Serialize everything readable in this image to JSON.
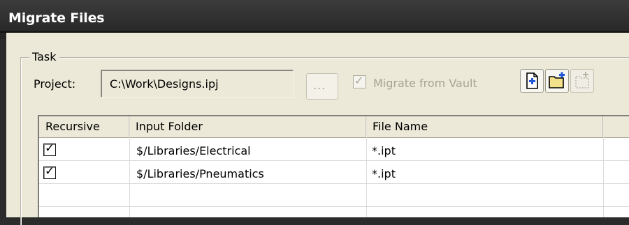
{
  "window": {
    "title": "Migrate Files"
  },
  "task": {
    "group_label": "Task",
    "project_label": "Project:",
    "project_value": "C:\\Work\\Designs.ipj",
    "browse_label": "...",
    "migrate_from_vault": {
      "label": "Migrate from Vault",
      "checked": true,
      "enabled": false
    }
  },
  "toolbar": {
    "buttons": [
      {
        "icon": "new-file-icon",
        "enabled": true
      },
      {
        "icon": "new-folder-icon",
        "enabled": true
      },
      {
        "icon": "remove-icon",
        "enabled": false
      }
    ]
  },
  "table": {
    "columns": [
      "Recursive",
      "Input Folder",
      "File Name",
      ""
    ],
    "rows": [
      {
        "recursive": true,
        "input_folder": "$/Libraries/Electrical",
        "file_name": "*.ipt"
      },
      {
        "recursive": true,
        "input_folder": "$/Libraries/Pneumatics",
        "file_name": "*.ipt"
      }
    ]
  },
  "colors": {
    "title_bar": "#2b2b2b",
    "dialog_bg": "#ece9d8",
    "disabled_text": "#a6a393"
  }
}
